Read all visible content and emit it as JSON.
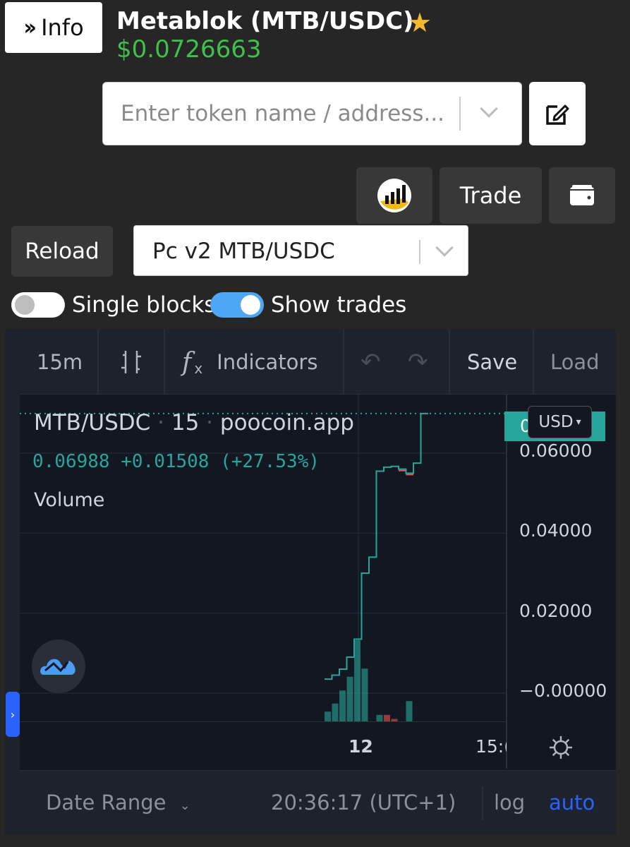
{
  "header": {
    "info_label": "Info",
    "title": "Metablok (MTB/USDC)",
    "price": "$0.0726663"
  },
  "search": {
    "placeholder": "Enter token name / address..."
  },
  "actions": {
    "trade_label": "Trade",
    "reload_label": "Reload"
  },
  "pair_select": {
    "value": "Pc v2 MTB/USDC"
  },
  "toggles": {
    "single_blocks": {
      "label": "Single blocks",
      "on": false
    },
    "show_trades": {
      "label": "Show trades",
      "on": true
    }
  },
  "chart_toolbar": {
    "interval": "15m",
    "indicators_label": "Indicators",
    "save_label": "Save",
    "load_label": "Load"
  },
  "chart_legend": {
    "symbol": "MTB/USDC",
    "interval": "15",
    "source": "poocoin.app",
    "last": "0.06988",
    "change": "+0.01508",
    "change_pct": "(+27.53%)",
    "volume_label": "Volume"
  },
  "price_axis": {
    "currency": "USD",
    "current_label": "0"
  },
  "chart_bottom": {
    "date_range_label": "Date Range",
    "clock": "20:36:17 (UTC+1)",
    "log_label": "log",
    "auto_label": "auto"
  },
  "colors": {
    "up": "#26a69a",
    "down": "#ef5350",
    "accent": "#2962ff",
    "price_green": "#3fbf4b"
  },
  "chart_data": {
    "type": "line",
    "ylim": [
      0,
      0.07
    ],
    "y_ticks": [
      "0.06000",
      "0.04000",
      "0.02000",
      "−0.00000"
    ],
    "x_ticks": [
      "12",
      "15:("
    ],
    "steps": [
      {
        "x": 0,
        "y": 0.0035
      },
      {
        "x": 1,
        "y": 0.0045
      },
      {
        "x": 2,
        "y": 0.006
      },
      {
        "x": 3,
        "y": 0.009
      },
      {
        "x": 4,
        "y": 0.0135
      },
      {
        "x": 5,
        "y": 0.03
      },
      {
        "x": 6,
        "y": 0.034
      },
      {
        "x": 7,
        "y": 0.0555
      },
      {
        "x": 8,
        "y": 0.0565
      },
      {
        "x": 9,
        "y": 0.0567
      },
      {
        "x": 10,
        "y": 0.056
      },
      {
        "x": 11,
        "y": 0.055
      },
      {
        "x": 12,
        "y": 0.0575
      },
      {
        "x": 13,
        "y": 0.0699
      }
    ],
    "volume": [
      {
        "x": 0,
        "v": 0.12,
        "dir": "up"
      },
      {
        "x": 1,
        "v": 0.22,
        "dir": "up"
      },
      {
        "x": 2,
        "v": 0.38,
        "dir": "up"
      },
      {
        "x": 3,
        "v": 0.55,
        "dir": "up"
      },
      {
        "x": 4,
        "v": 1.0,
        "dir": "up"
      },
      {
        "x": 5,
        "v": 0.65,
        "dir": "up"
      },
      {
        "x": 7,
        "v": 0.08,
        "dir": "up"
      },
      {
        "x": 8,
        "v": 0.08,
        "dir": "down"
      },
      {
        "x": 9,
        "v": 0.03,
        "dir": "down"
      },
      {
        "x": 11,
        "v": 0.25,
        "dir": "up"
      }
    ]
  }
}
